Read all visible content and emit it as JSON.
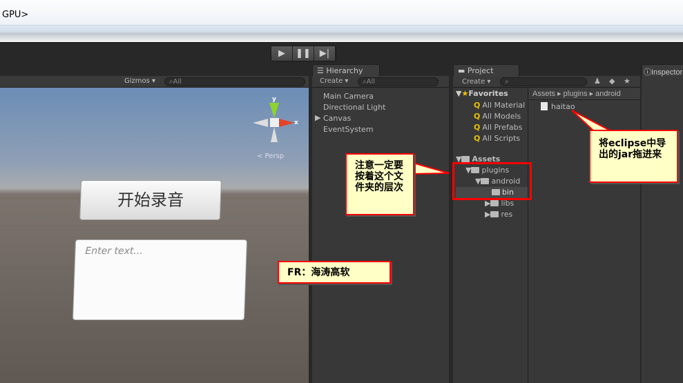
{
  "window": {
    "title": "GPU>"
  },
  "playbar": {
    "play": "▶",
    "pause": "❚❚",
    "step": "▶|"
  },
  "scene": {
    "gizmos": "Gizmos ▾",
    "search_placeholder": "All",
    "axis_y": "y",
    "axis_x": "x",
    "persp": "< Persp",
    "button_label": "开始录音",
    "input_placeholder": "Enter text..."
  },
  "hierarchy": {
    "tab": "Hierarchy",
    "create": "Create ▾",
    "search_placeholder": "All",
    "items": [
      "Main Camera",
      "Directional Light",
      "Canvas",
      "EventSystem"
    ]
  },
  "project": {
    "tab": "Project",
    "create": "Create ▾",
    "favorites": {
      "label": "Favorites",
      "items": [
        "All Material",
        "All Models",
        "All Prefabs",
        "All Scripts"
      ]
    },
    "assets": {
      "label": "Assets",
      "tree": [
        "plugins",
        "android",
        "bin",
        "libs",
        "res"
      ]
    },
    "breadcrumb": [
      "Assets",
      "plugins",
      "android"
    ],
    "files": [
      "haitao"
    ]
  },
  "inspector": {
    "tab": "Inspector"
  },
  "annotations": {
    "folder_note": "注意一定要按着这个文件夹的层次",
    "jar_note": "将eclipse中导出的jar拖进来",
    "credit": "FR：海涛高软"
  }
}
